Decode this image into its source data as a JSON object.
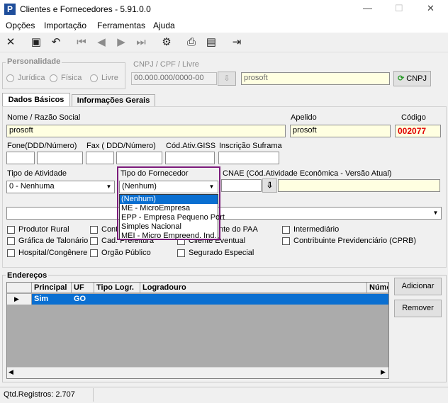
{
  "window": {
    "title": "Clientes e Fornecedores - 5.91.0.0",
    "min": "—",
    "max": "☐",
    "close": "✕"
  },
  "menu": [
    "Opções",
    "Importação",
    "Ferramentas",
    "Ajuda"
  ],
  "personalidade": {
    "label": "Personalidade",
    "options": [
      "Jurídica",
      "Física",
      "Livre"
    ]
  },
  "cnpj": {
    "label": "CNPJ / CPF / Livre",
    "value": "00.000.000/0000-00",
    "name_value": "prosoft",
    "button": "CNPJ"
  },
  "tabs": [
    "Dados Básicos",
    "Informações Gerais"
  ],
  "fields": {
    "nome_label": "Nome / Razão Social",
    "nome": "prosoft",
    "apelido_label": "Apelido",
    "apelido": "prosoft",
    "codigo_label": "Código",
    "codigo": "002077",
    "fone_label": "Fone(DDD/Número)",
    "fax_label": "Fax ( DDD/Número)",
    "cod_giss_label": "Cód.Ativ.GISS",
    "insc_suframa_label": "Inscrição Suframa",
    "tipo_atividade_label": "Tipo de Atividade",
    "tipo_atividade": "0 - Nenhuma",
    "tipo_fornecedor_label": "Tipo do Fornecedor",
    "tipo_fornecedor": "(Nenhum)",
    "cnae_label": "CNAE (Cód.Atividade Econômica - Versão Atual)"
  },
  "dropdown": [
    "(Nenhum)",
    "ME - MicroEmpresa",
    "EPP - Empresa Pequeno Port",
    "Simples Nacional",
    "MEI - Micro Empreend. Ind."
  ],
  "checks": {
    "produtor_rural": "Produtor Rural",
    "cont": "Cont",
    "paa": "nte do PAA",
    "intermediario": "Intermediário",
    "grafica": "Gráfica de Talonário",
    "cad_prefeitura": "Cad. Prefeitura",
    "cliente_eventual": "Cliente Eventual",
    "contribuinte": "Contribuinte Previdenciário (CPRB)",
    "hospital": "Hospital/Congênere",
    "orgao": "Orgão Público",
    "segurado": "Segurado Especial"
  },
  "enderecos": {
    "label": "Endereços",
    "columns": [
      "Principal",
      "UF",
      "Tipo Logr.",
      "Logradouro",
      "Núme"
    ],
    "row": [
      "Sim",
      "GO",
      "",
      "",
      ""
    ],
    "add": "Adicionar",
    "remove": "Remover"
  },
  "status": {
    "text": "Qtd.Registros: 2.707"
  },
  "colors": {
    "accent": "#0a6fd1",
    "highlight": "#7b1b7b",
    "code": "#e00000"
  }
}
